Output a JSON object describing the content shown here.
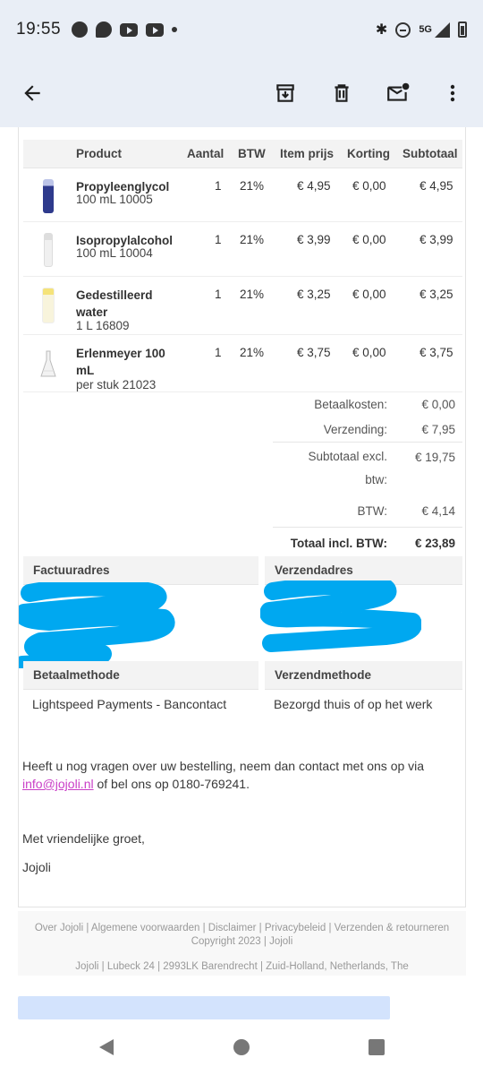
{
  "status_bar": {
    "time": "19:55",
    "network": "5G",
    "icons": [
      "messenger-icon",
      "chat-icon",
      "youtube-icon",
      "youtube-icon",
      "dot-icon",
      "bluetooth-icon",
      "dnd-icon",
      "signal-icon",
      "battery-icon"
    ]
  },
  "toolbar": {
    "icons": [
      "back-arrow-icon",
      "archive-icon",
      "delete-icon",
      "mark-unread-icon",
      "more-vert-icon"
    ]
  },
  "order": {
    "headers": {
      "product": "Product",
      "qty": "Aantal",
      "vat": "BTW",
      "unit_price": "Item prijs",
      "discount": "Korting",
      "subtotal": "Subtotaal"
    },
    "items": [
      {
        "name": "Propyleenglycol",
        "sub": "100 mL 10005",
        "qty": "1",
        "vat": "21%",
        "price": "€ 4,95",
        "discount": "€ 0,00",
        "subtotal": "€ 4,95"
      },
      {
        "name": "Isopropylalcohol",
        "sub": "100 mL 10004",
        "qty": "1",
        "vat": "21%",
        "price": "€ 3,99",
        "discount": "€ 0,00",
        "subtotal": "€ 3,99"
      },
      {
        "name": "Gedestilleerd water",
        "sub": "1 L 16809",
        "qty": "1",
        "vat": "21%",
        "price": "€ 3,25",
        "discount": "€ 0,00",
        "subtotal": "€ 3,25"
      },
      {
        "name": "Erlenmeyer 100 mL",
        "sub": "per stuk 21023",
        "qty": "1",
        "vat": "21%",
        "price": "€ 3,75",
        "discount": "€ 0,00",
        "subtotal": "€ 3,75"
      }
    ],
    "totals": {
      "payment_costs_label": "Betaalkosten:",
      "payment_costs": "€ 0,00",
      "shipping_label": "Verzending:",
      "shipping": "€ 7,95",
      "subtotal_excl_label": "Subtotaal excl. btw:",
      "subtotal_excl": "€ 19,75",
      "vat_label": "BTW:",
      "vat": "€ 4,14",
      "total_label": "Totaal incl. BTW:",
      "total": "€ 23,89"
    }
  },
  "addresses": {
    "billing_title": "Factuuradres",
    "shipping_title": "Verzendadres",
    "payment_method_title": "Betaalmethode",
    "payment_method": "Lightspeed Payments - Bancontact",
    "shipping_method_title": "Verzendmethode",
    "shipping_method": "Bezorgd thuis of op het werk"
  },
  "message": {
    "questions_pre": "Heeft u nog vragen over uw bestelling, neem dan contact met ons op via",
    "email": "info@jojoli.nl",
    "questions_post": "of bel ons op 0180-769241.",
    "greeting": "Met vriendelijke groet,",
    "signature": "Jojoli"
  },
  "footer": {
    "links": [
      "Over Jojoli",
      "Algemene voorwaarden",
      "Disclaimer",
      "Privacybeleid",
      "Verzenden & retourneren"
    ],
    "copyright": "Copyright 2023 | Jojoli",
    "address": "Jojoli | Lubeck 24 | 2993LK Barendrecht | Zuid-Holland, Netherlands, The"
  },
  "colors": {
    "toolbar_bg": "#e9eef6",
    "link": "#c93fc7",
    "redaction": "#00a8f0",
    "reply_bar": "#d3e3fd"
  }
}
